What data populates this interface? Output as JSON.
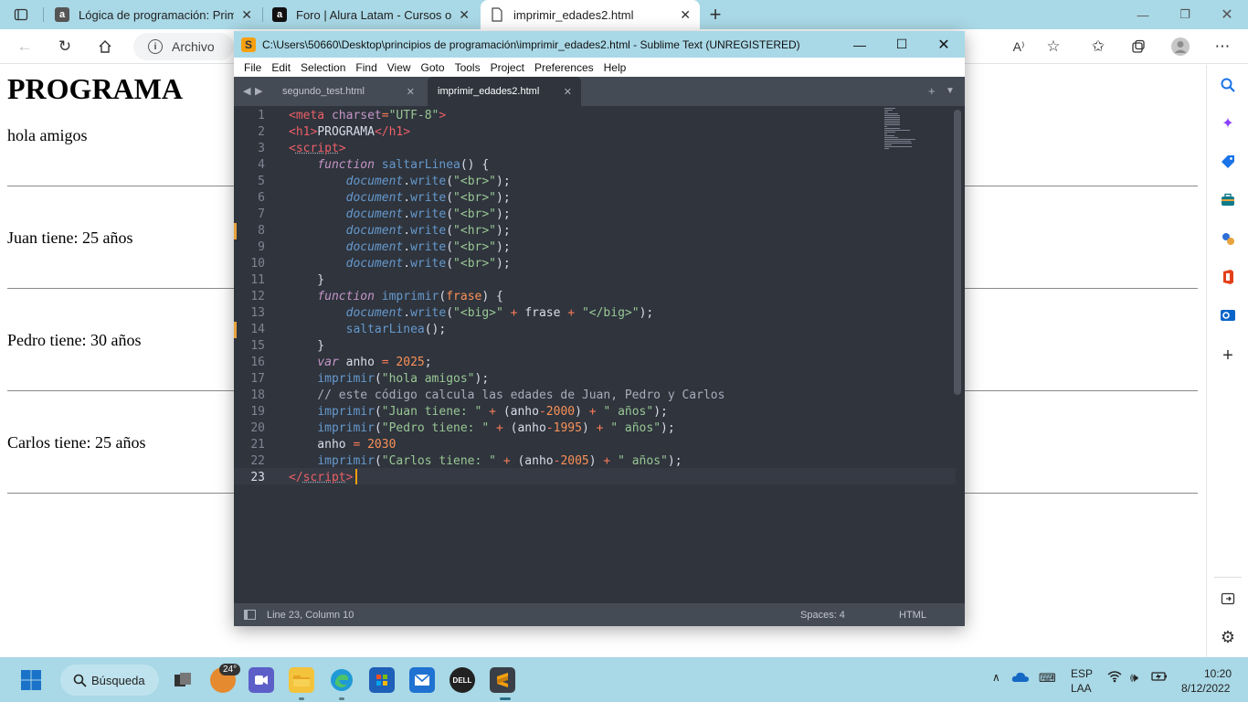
{
  "browser": {
    "tabs": [
      {
        "favicon": "a",
        "title": "Lógica de programación: Primer",
        "close": "✕"
      },
      {
        "favicon": "a",
        "title": "Foro | Alura Latam - Cursos onlin",
        "close": "✕"
      },
      {
        "favicon": "doc",
        "title": "imprimir_edades2.html",
        "close": "✕"
      }
    ],
    "new_tab": "+",
    "address_label": "Archivo"
  },
  "page": {
    "heading": "PROGRAMA",
    "lines": [
      "hola amigos",
      "Juan tiene: 25 años",
      "Pedro tiene: 30 años",
      "Carlos tiene: 25 años"
    ]
  },
  "sublime": {
    "title": "C:\\Users\\50660\\Desktop\\principios de programación\\imprimir_edades2.html - Sublime Text (UNREGISTERED)",
    "menu": [
      "File",
      "Edit",
      "Selection",
      "Find",
      "View",
      "Goto",
      "Tools",
      "Project",
      "Preferences",
      "Help"
    ],
    "tabs": [
      {
        "label": "segundo_test.html",
        "close": "✕",
        "active": false
      },
      {
        "label": "imprimir_edades2.html",
        "close": "✕",
        "active": true
      }
    ],
    "line_numbers": [
      "1",
      "2",
      "3",
      "4",
      "5",
      "6",
      "7",
      "8",
      "9",
      "10",
      "11",
      "12",
      "13",
      "14",
      "15",
      "16",
      "17",
      "18",
      "19",
      "20",
      "21",
      "22",
      "23"
    ],
    "code_lines": [
      [
        [
          "tag",
          "<meta "
        ],
        [
          "attr",
          "charset"
        ],
        [
          "op",
          "="
        ],
        [
          "str",
          "\"UTF-8\""
        ],
        [
          "tag",
          ">"
        ]
      ],
      [
        [
          "tag",
          "<h1>"
        ],
        [
          "txt",
          "PROGRAMA"
        ],
        [
          "tag",
          "</h1>"
        ]
      ],
      [
        [
          "tag",
          "<"
        ],
        [
          "tagul",
          "script"
        ],
        [
          "tag",
          ">"
        ]
      ],
      [
        [
          "txt",
          "    "
        ],
        [
          "kw",
          "function"
        ],
        [
          "txt",
          " "
        ],
        [
          "fn",
          "saltarLinea"
        ],
        [
          "txt",
          "() {"
        ]
      ],
      [
        [
          "txt",
          "        "
        ],
        [
          "obj",
          "document"
        ],
        [
          "txt",
          "."
        ],
        [
          "fn",
          "write"
        ],
        [
          "txt",
          "("
        ],
        [
          "str",
          "\"<br>\""
        ],
        [
          "txt",
          ");"
        ]
      ],
      [
        [
          "txt",
          "        "
        ],
        [
          "obj",
          "document"
        ],
        [
          "txt",
          "."
        ],
        [
          "fn",
          "write"
        ],
        [
          "txt",
          "("
        ],
        [
          "str",
          "\"<br>\""
        ],
        [
          "txt",
          ");"
        ]
      ],
      [
        [
          "txt",
          "        "
        ],
        [
          "obj",
          "document"
        ],
        [
          "txt",
          "."
        ],
        [
          "fn",
          "write"
        ],
        [
          "txt",
          "("
        ],
        [
          "str",
          "\"<br>\""
        ],
        [
          "txt",
          ");"
        ]
      ],
      [
        [
          "txt",
          "        "
        ],
        [
          "obj",
          "document"
        ],
        [
          "txt",
          "."
        ],
        [
          "fn",
          "write"
        ],
        [
          "txt",
          "("
        ],
        [
          "str",
          "\"<hr>\""
        ],
        [
          "txt",
          ");"
        ]
      ],
      [
        [
          "txt",
          "        "
        ],
        [
          "obj",
          "document"
        ],
        [
          "txt",
          "."
        ],
        [
          "fn",
          "write"
        ],
        [
          "txt",
          "("
        ],
        [
          "str",
          "\"<br>\""
        ],
        [
          "txt",
          ");"
        ]
      ],
      [
        [
          "txt",
          "        "
        ],
        [
          "obj",
          "document"
        ],
        [
          "txt",
          "."
        ],
        [
          "fn",
          "write"
        ],
        [
          "txt",
          "("
        ],
        [
          "str",
          "\"<br>\""
        ],
        [
          "txt",
          ");"
        ]
      ],
      [
        [
          "txt",
          "    }"
        ]
      ],
      [
        [
          "txt",
          "    "
        ],
        [
          "kw",
          "function"
        ],
        [
          "txt",
          " "
        ],
        [
          "fn",
          "imprimir"
        ],
        [
          "txt",
          "("
        ],
        [
          "num",
          "frase"
        ],
        [
          "txt",
          ") {"
        ]
      ],
      [
        [
          "txt",
          "        "
        ],
        [
          "obj",
          "document"
        ],
        [
          "txt",
          "."
        ],
        [
          "fn",
          "write"
        ],
        [
          "txt",
          "("
        ],
        [
          "str",
          "\"<big>\""
        ],
        [
          "txt",
          " "
        ],
        [
          "op",
          "+"
        ],
        [
          "txt",
          " frase "
        ],
        [
          "op",
          "+"
        ],
        [
          "txt",
          " "
        ],
        [
          "str",
          "\"</big>\""
        ],
        [
          "txt",
          ");"
        ]
      ],
      [
        [
          "txt",
          "        "
        ],
        [
          "fn",
          "saltarLinea"
        ],
        [
          "txt",
          "();"
        ]
      ],
      [
        [
          "txt",
          "    }"
        ]
      ],
      [
        [
          "txt",
          "    "
        ],
        [
          "kw",
          "var"
        ],
        [
          "txt",
          " anho "
        ],
        [
          "op",
          "="
        ],
        [
          "txt",
          " "
        ],
        [
          "num",
          "2025"
        ],
        [
          "txt",
          ";"
        ]
      ],
      [
        [
          "txt",
          "    "
        ],
        [
          "fn",
          "imprimir"
        ],
        [
          "txt",
          "("
        ],
        [
          "str",
          "\"hola amigos\""
        ],
        [
          "txt",
          ");"
        ]
      ],
      [
        [
          "txt",
          "    "
        ],
        [
          "com",
          "// este código calcula las edades de Juan, Pedro y Carlos"
        ]
      ],
      [
        [
          "txt",
          "    "
        ],
        [
          "fn",
          "imprimir"
        ],
        [
          "txt",
          "("
        ],
        [
          "str",
          "\"Juan tiene: \""
        ],
        [
          "txt",
          " "
        ],
        [
          "op",
          "+"
        ],
        [
          "txt",
          " (anho"
        ],
        [
          "op",
          "-"
        ],
        [
          "num",
          "2000"
        ],
        [
          "txt",
          ") "
        ],
        [
          "op",
          "+"
        ],
        [
          "txt",
          " "
        ],
        [
          "str",
          "\" años\""
        ],
        [
          "txt",
          ");"
        ]
      ],
      [
        [
          "txt",
          "    "
        ],
        [
          "fn",
          "imprimir"
        ],
        [
          "txt",
          "("
        ],
        [
          "str",
          "\"Pedro tiene: \""
        ],
        [
          "txt",
          " "
        ],
        [
          "op",
          "+"
        ],
        [
          "txt",
          " (anho"
        ],
        [
          "op",
          "-"
        ],
        [
          "num",
          "1995"
        ],
        [
          "txt",
          ") "
        ],
        [
          "op",
          "+"
        ],
        [
          "txt",
          " "
        ],
        [
          "str",
          "\" años\""
        ],
        [
          "txt",
          ");"
        ]
      ],
      [
        [
          "txt",
          "    anho "
        ],
        [
          "op",
          "="
        ],
        [
          "txt",
          " "
        ],
        [
          "num",
          "2030"
        ]
      ],
      [
        [
          "txt",
          "    "
        ],
        [
          "fn",
          "imprimir"
        ],
        [
          "txt",
          "("
        ],
        [
          "str",
          "\"Carlos tiene: \""
        ],
        [
          "txt",
          " "
        ],
        [
          "op",
          "+"
        ],
        [
          "txt",
          " (anho"
        ],
        [
          "op",
          "-"
        ],
        [
          "num",
          "2005"
        ],
        [
          "txt",
          ") "
        ],
        [
          "op",
          "+"
        ],
        [
          "txt",
          " "
        ],
        [
          "str",
          "\" años\""
        ],
        [
          "txt",
          ");"
        ]
      ],
      [
        [
          "tag",
          "</"
        ],
        [
          "tagul",
          "script"
        ],
        [
          "tag",
          ">"
        ]
      ]
    ],
    "modified_lines": [
      8,
      14
    ],
    "current_line": 23,
    "status": {
      "position": "Line 23, Column 10",
      "spaces": "Spaces: 4",
      "syntax": "HTML"
    }
  },
  "taskbar": {
    "search_label": "Búsqueda",
    "weather_badge": "24°",
    "language": "ESP",
    "region": "LAA",
    "time": "10:20",
    "date": "8/12/2022"
  },
  "colors": {
    "chrome": "#a9d8e6",
    "editor_bg": "#2f343d",
    "accent": "#f6a00f"
  }
}
